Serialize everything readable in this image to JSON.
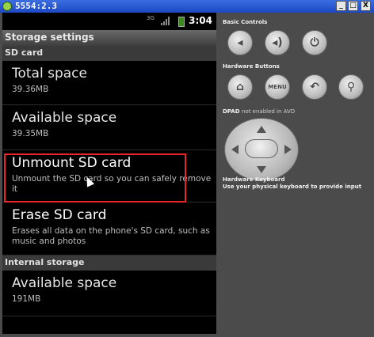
{
  "window": {
    "title": "5554:2.3",
    "minimize": "_",
    "maximize": "□",
    "close": "X"
  },
  "status": {
    "time": "3:04",
    "network": "3G"
  },
  "app": {
    "title": "Storage settings"
  },
  "sections": {
    "sd": "SD card",
    "internal": "Internal storage"
  },
  "items": [
    {
      "title": "Total space",
      "subtitle": "39.36MB"
    },
    {
      "title": "Available space",
      "subtitle": "39.35MB"
    },
    {
      "title": "Unmount SD card",
      "subtitle": "Unmount the SD card so you can safely remove it"
    },
    {
      "title": "Erase SD card",
      "subtitle": "Erases all data on the phone's SD card, such as music and photos"
    },
    {
      "title": "Available space",
      "subtitle": "191MB"
    }
  ],
  "panel": {
    "basic_controls": "Basic Controls",
    "hardware_buttons": "Hardware Buttons",
    "dpad_label": "DPAD",
    "dpad_note": "not enabled in AVD",
    "keyboard_label": "Hardware Keyboard",
    "keyboard_note": "Use your physical keyboard to provide input",
    "menu": "MENU"
  }
}
